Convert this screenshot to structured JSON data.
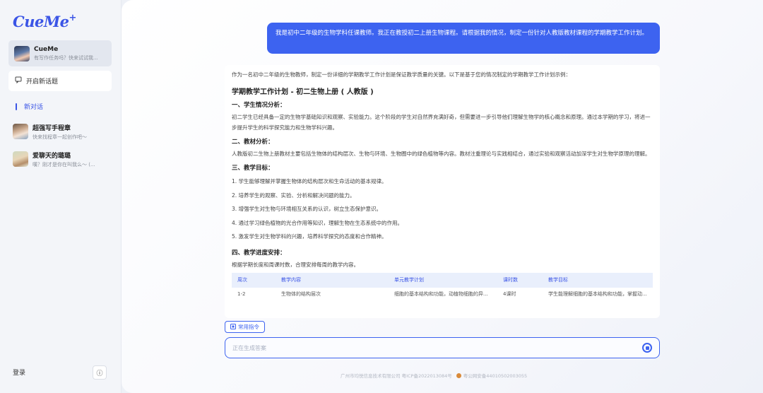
{
  "app": {
    "logo": "CueMe",
    "logo_plus": "+"
  },
  "sidebar": {
    "bot_card": {
      "title": "CueMe",
      "subtitle": "有写作任务吗？快来试试我..."
    },
    "new_topic_label": "开启新话题",
    "new_chat_label": "新对话",
    "conversations": [
      {
        "title": "超强写手程章",
        "subtitle": "快来找程章一起创作吧～"
      },
      {
        "title": "爱聊天的璐璐",
        "subtitle": "嘆？刚才是你在叫我么～ (..."
      }
    ],
    "login_label": "登录",
    "info_icon_glyph": "ⓘ"
  },
  "chat": {
    "user_message": "我是初中二年级的生物学科任课教师。我正在教授初二上册生物课程。请根据我的情况，制定一份针对人教版教材课程的学期教学工作计划。",
    "answer": {
      "intro": "作为一名初中二年级的生物教师，制定一份详细的学期教学工作计划是保证教学质量的关键。以下是基于您的情况制定的学期教学工作计划示例：",
      "title": "学期教学工作计划 - 初二生物上册 ( 人教版 )",
      "s1_heading": "一、学生情况分析：",
      "s1_text": "初二学生已经具备一定的生物学基础知识和观察、实验能力。这个阶段的学生对自然界充满好奇，但需要进一步引导他们理解生物学的核心概念和原理。通过本学期的学习，将进一步提升学生的科学探究能力和生物学科兴趣。",
      "s2_heading": "二、教材分析：",
      "s2_text": "人教版初二生物上册教材主要包括生物体的结构层次、生物与环境、生物圈中的绿色植物等内容。教材注重理论与实践相结合，通过实验和观察活动加深学生对生物学原理的理解。",
      "s3_heading": "三、教学目标：",
      "goals": [
        "1. 学生能够理解并掌握生物体的结构层次和生命活动的基本规律。",
        "2. 培养学生的观察、实验、分析和解决问题的能力。",
        "3. 增强学生对生物与环境相互关系的认识，树立生态保护意识。",
        "4. 通过学习绿色植物的光合作用等知识，理解生物在生态系统中的作用。",
        "5. 激发学生对生物学科的兴趣，培养科学探究的态度和合作精神。"
      ],
      "s4_heading": "四、教学进度安排：",
      "s4_text": "根据学期长度和周课时数，合理安排每周的教学内容。",
      "table": {
        "headers": [
          "周次",
          "教学内容",
          "单元教学计划",
          "课时数",
          "教学目标"
        ],
        "row1": [
          "1-2",
          "生物体的结构层次",
          "细胞的基本结构和功能，动植物细胞的异...",
          "4课时",
          "学生能理解细胞的基本结构和功能，掌握动..."
        ]
      }
    }
  },
  "composer": {
    "common_cmd_label": "常用指令",
    "placeholder": "正在生成答案"
  },
  "footer": {
    "icp": "广州市均悦信息技术有限公司 粤ICP备2022013084号",
    "police": "粤公网安备44010502003055"
  },
  "colors": {
    "accent": "#3d63f0",
    "sidebar_bg": "#f3f5f9"
  }
}
